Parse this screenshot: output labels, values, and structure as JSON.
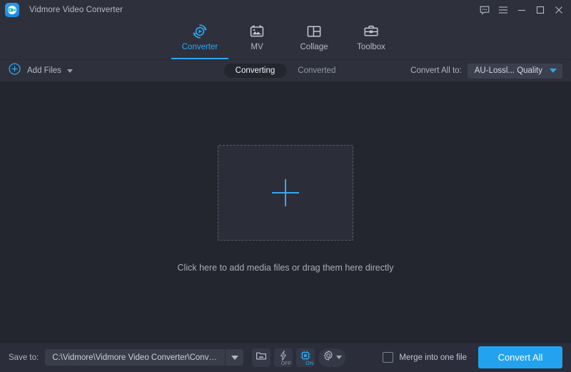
{
  "window": {
    "title": "Vidmore Video Converter",
    "app_icon": "camcorder-icon",
    "controls": {
      "feedback": "feedback-bubble-icon",
      "menu": "hamburger-menu-icon",
      "minimize": "minimize-icon",
      "maximize": "maximize-icon",
      "close": "close-icon"
    }
  },
  "nav": {
    "tabs": [
      {
        "label": "Converter",
        "icon": "converter-icon",
        "active": true
      },
      {
        "label": "MV",
        "icon": "mv-icon",
        "active": false
      },
      {
        "label": "Collage",
        "icon": "collage-icon",
        "active": false
      },
      {
        "label": "Toolbox",
        "icon": "toolbox-icon",
        "active": false
      }
    ]
  },
  "toolbar": {
    "add_files_label": "Add Files",
    "add_files_icon": "plus-circle-icon",
    "segments": [
      {
        "label": "Converting",
        "active": true
      },
      {
        "label": "Converted",
        "active": false
      }
    ],
    "convert_all_to_label": "Convert All to:",
    "preset_value": "AU-Lossl... Quality"
  },
  "main": {
    "dropzone_icon": "plus-icon",
    "caption": "Click here to add media files or drag them here directly"
  },
  "bottom": {
    "save_to_label": "Save to:",
    "save_path": "C:\\Vidmore\\Vidmore Video Converter\\Converted",
    "tools": [
      {
        "name": "open-folder-icon",
        "badge": ""
      },
      {
        "name": "lightning-bolt-icon",
        "badge": "OFF",
        "state": "off"
      },
      {
        "name": "cpu-chip-icon",
        "badge": "ON",
        "state": "on"
      },
      {
        "name": "settings-gear-icon",
        "badge": ""
      }
    ],
    "merge_label": "Merge into one file",
    "merge_checked": false,
    "convert_all_label": "Convert All"
  },
  "colors": {
    "accent": "#29a8f2",
    "button": "#23a3ef",
    "titlebar_bg": "#2e303c",
    "main_bg": "#23252f",
    "bottombar_bg": "#2b2d3a"
  }
}
